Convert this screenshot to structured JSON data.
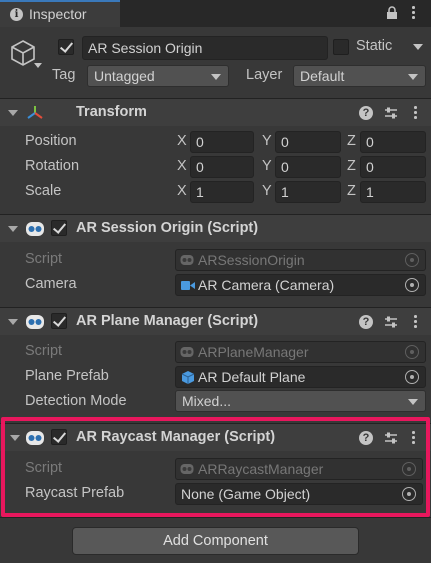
{
  "window": {
    "tab_label": "Inspector"
  },
  "object": {
    "name": "AR Session Origin",
    "active": true,
    "static_label": "Static",
    "static_checked": false,
    "tag_label": "Tag",
    "tag_value": "Untagged",
    "layer_label": "Layer",
    "layer_value": "Default"
  },
  "transform": {
    "title": "Transform",
    "rows": [
      {
        "label": "Position",
        "x": "0",
        "y": "0",
        "z": "0"
      },
      {
        "label": "Rotation",
        "x": "0",
        "y": "0",
        "z": "0"
      },
      {
        "label": "Scale",
        "x": "1",
        "y": "1",
        "z": "1"
      }
    ],
    "axis": {
      "x": "X",
      "y": "Y",
      "z": "Z"
    }
  },
  "session_origin": {
    "title": "AR Session Origin (Script)",
    "script_label": "Script",
    "script_value": "ARSessionOrigin",
    "camera_label": "Camera",
    "camera_value": "AR Camera (Camera)"
  },
  "plane_manager": {
    "title": "AR Plane Manager (Script)",
    "script_label": "Script",
    "script_value": "ARPlaneManager",
    "prefab_label": "Plane Prefab",
    "prefab_value": "AR Default Plane",
    "mode_label": "Detection Mode",
    "mode_value": "Mixed..."
  },
  "raycast_manager": {
    "title": "AR Raycast Manager (Script)",
    "script_label": "Script",
    "script_value": "ARRaycastManager",
    "prefab_label": "Raycast Prefab",
    "prefab_value": "None (Game Object)"
  },
  "footer": {
    "add_component_label": "Add Component"
  },
  "colors": {
    "highlight": "#e8175d",
    "tab_accent": "#3a79bb",
    "background": "#383838"
  }
}
